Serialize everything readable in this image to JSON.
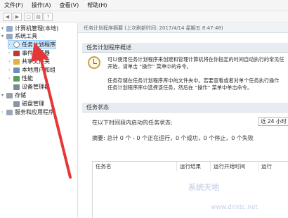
{
  "menubar": {
    "items": [
      "文件(F)",
      "操作(A)",
      "查看(V)",
      "帮助(H)"
    ]
  },
  "tree": {
    "root": "计算机管理(本地)",
    "system_tools": "系统工具",
    "task_scheduler": "任务计划程序",
    "event_viewer": "事件查看器",
    "shared_folders": "共享文件夹",
    "local_users": "本地用户和组",
    "performance": "性能",
    "device_manager": "设备管理器",
    "storage": "存储",
    "disk_management": "磁盘管理",
    "services_apps": "服务和应用程序"
  },
  "right": {
    "header": "任务计划程序摘要 (上次刷新时间: 2017/4/14 星期五 8:47:48)",
    "overview_title": "任务计划程序概述",
    "overview_lines": [
      "可以使用任务计划程序来创建和管理计算机将在你指定的时间自动执行的常见任",
      "开始，请单击 “操作” 菜单中的命令。",
      "任务存储在任务计划程序库中的文件夹中。若要查看或者对单个任务执行操作",
      "任务计划程序库中选择该任务，然后在 “操作” 菜单中单击命令。"
    ],
    "status_title": "任务状态",
    "status_prompt": "在以下时间段内启动的任务状态:",
    "period_selected": "近 24 小时",
    "summary": "摘要: 总计 0 个 - 0 个正在运行，0 个成功，0 个停止，0 个失败",
    "columns": [
      "任务名",
      "运行结果",
      "运行开始时间",
      "运行"
    ]
  },
  "watermark": {
    "text": "系统天地",
    "url": "www.dnxtc.net"
  },
  "colors": {
    "arrow": "#e5373a",
    "selection": "#cce8ff"
  }
}
